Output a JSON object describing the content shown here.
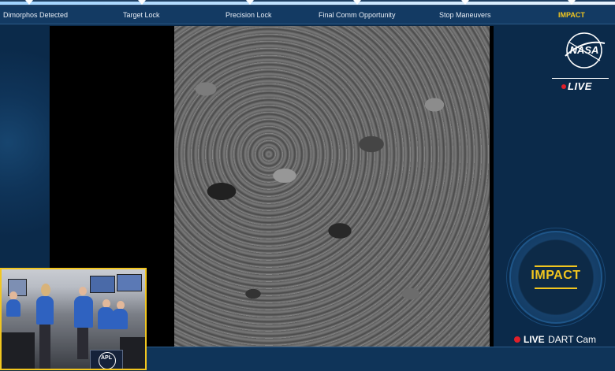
{
  "progress": {
    "fraction": 1.0
  },
  "milestones": [
    {
      "label": "Dimorphos Detected",
      "active": false
    },
    {
      "label": "Target Lock",
      "active": false
    },
    {
      "label": "Precision Lock",
      "active": false
    },
    {
      "label": "Final Comm Opportunity",
      "active": false
    },
    {
      "label": "Stop Maneuvers",
      "active": false
    },
    {
      "label": "IMPACT",
      "active": true
    }
  ],
  "branding": {
    "logo_text": "NASA",
    "live_label": "LIVE"
  },
  "impact_badge": {
    "label": "IMPACT"
  },
  "live_cam": {
    "live": "LIVE",
    "label": "DART Cam"
  },
  "pip": {
    "sign_text": "APL"
  },
  "colors": {
    "accent": "#f2c61f",
    "panel": "#0b2a4a",
    "strip": "#133a63",
    "live_red": "#e0202a"
  },
  "icons": {
    "logo": "nasa-meatball-icon",
    "live_dot": "live-dot-icon"
  }
}
